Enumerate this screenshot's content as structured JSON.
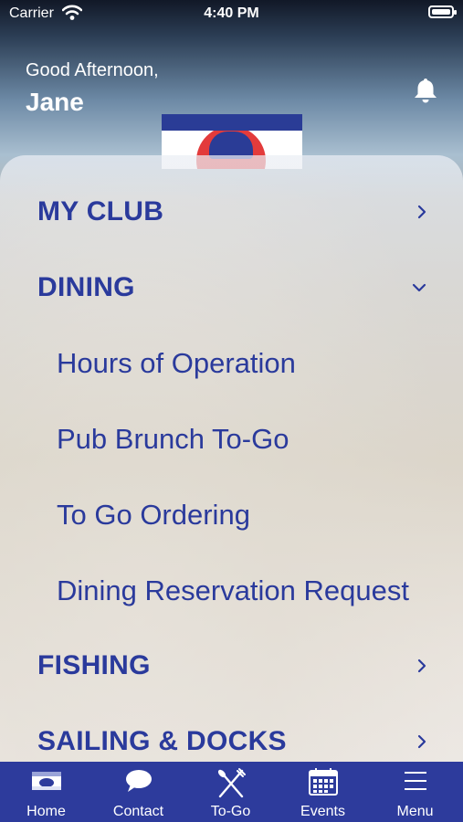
{
  "status_bar": {
    "carrier": "Carrier",
    "time": "4:40 PM"
  },
  "header": {
    "greeting": "Good Afternoon,",
    "user_name": "Jane"
  },
  "menu": {
    "items": [
      {
        "label": "MY CLUB",
        "type": "section",
        "chevron": "right"
      },
      {
        "label": "DINING",
        "type": "section",
        "chevron": "down"
      },
      {
        "label": "Hours of Operation",
        "type": "subitem"
      },
      {
        "label": "Pub Brunch To-Go",
        "type": "subitem"
      },
      {
        "label": "To Go Ordering",
        "type": "subitem"
      },
      {
        "label": "Dining Reservation Request",
        "type": "subitem"
      },
      {
        "label": "FISHING",
        "type": "section",
        "chevron": "right"
      },
      {
        "label": "SAILING & DOCKS",
        "type": "section",
        "chevron": "right"
      }
    ]
  },
  "tab_bar": {
    "tabs": [
      {
        "label": "Home",
        "icon": "club-flag-icon"
      },
      {
        "label": "Contact",
        "icon": "chat-bubble-icon"
      },
      {
        "label": "To-Go",
        "icon": "fork-knife-icon"
      },
      {
        "label": "Events",
        "icon": "calendar-icon"
      },
      {
        "label": "Menu",
        "icon": "hamburger-menu-icon"
      }
    ]
  },
  "colors": {
    "brand_blue": "#2d3b9c",
    "menu_text": "#2a3a9c",
    "accent_red": "#e33b3b"
  }
}
